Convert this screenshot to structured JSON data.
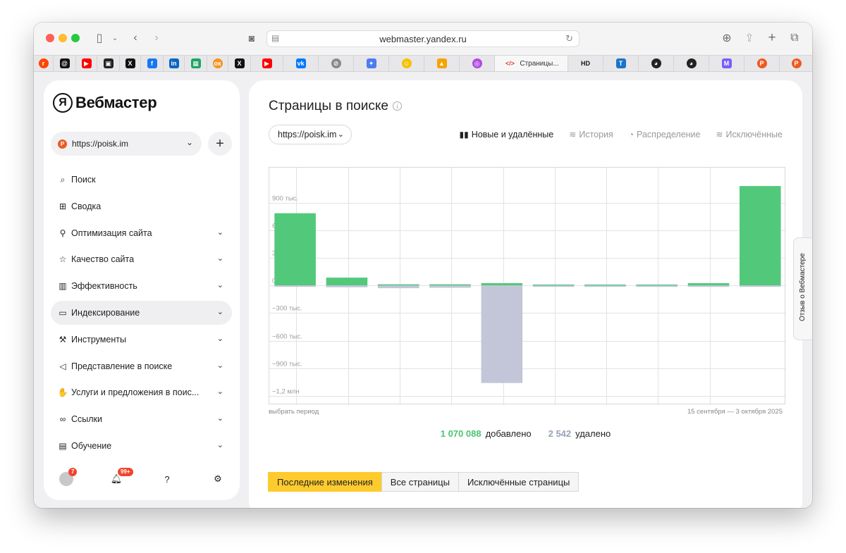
{
  "browser": {
    "address": "webmaster.yandex.ru",
    "tabs": [
      {
        "icon": "reddit-icon",
        "color": "#ff4500",
        "glyph": "r"
      },
      {
        "icon": "threads-icon",
        "color": "#111111",
        "glyph": "@"
      },
      {
        "icon": "youtube-icon",
        "color": "#ff0000",
        "glyph": "▶"
      },
      {
        "icon": "square-app-icon",
        "color": "#222222",
        "glyph": "▣"
      },
      {
        "icon": "x-icon",
        "color": "#111111",
        "glyph": "X"
      },
      {
        "icon": "facebook-icon",
        "color": "#1877f2",
        "glyph": "f"
      },
      {
        "icon": "linkedin-icon",
        "color": "#0a66c2",
        "glyph": "in"
      },
      {
        "icon": "sheets-icon",
        "color": "#1fa463",
        "glyph": "▦"
      },
      {
        "icon": "odnoklassniki-icon",
        "color": "#f7931e",
        "glyph": "ок"
      },
      {
        "icon": "x-icon",
        "color": "#111111",
        "glyph": "X"
      },
      {
        "icon": "youtube-icon",
        "color": "#ff0000",
        "glyph": "▶"
      },
      {
        "icon": "vk-icon",
        "color": "#0077ff",
        "glyph": "vk"
      },
      {
        "icon": "compass-icon",
        "color": "#8a8a8a",
        "glyph": "⊘"
      },
      {
        "icon": "gemini-icon",
        "color": "#4a7df0",
        "glyph": "✦"
      },
      {
        "icon": "smiley-icon",
        "color": "#f4c300",
        "glyph": "☺"
      },
      {
        "icon": "analytics-icon",
        "color": "#f4a400",
        "glyph": "▲"
      },
      {
        "icon": "podcast-icon",
        "color": "#b04be0",
        "glyph": "◎"
      },
      {
        "icon": "code-icon",
        "color": "#e23d2d",
        "glyph": "</>",
        "title": "Страницы...",
        "active": true
      },
      {
        "icon": "hd-icon",
        "color": "#111111",
        "glyph": "HD"
      },
      {
        "icon": "t-icon",
        "color": "#1a73c9",
        "glyph": "T"
      },
      {
        "icon": "ninja-icon",
        "color": "#222222",
        "glyph": "◕"
      },
      {
        "icon": "ninja-icon",
        "color": "#222222",
        "glyph": "◕"
      },
      {
        "icon": "m-icon",
        "color": "#7b5cff",
        "glyph": "M"
      },
      {
        "icon": "poisk-icon",
        "color": "#ee5a22",
        "glyph": "P"
      },
      {
        "icon": "poisk-icon",
        "color": "#ee5a22",
        "glyph": "P"
      }
    ]
  },
  "sidebar": {
    "logo_mark": "Я",
    "logo_text": "Вебмастер",
    "site_url": "https://poisk.im",
    "add_label": "+",
    "items": [
      {
        "label": "Поиск",
        "icon": "search-icon",
        "glyph": "⌕",
        "chevron": false
      },
      {
        "label": "Сводка",
        "icon": "grid-icon",
        "glyph": "⊞",
        "chevron": false
      },
      {
        "label": "Оптимизация сайта",
        "icon": "sitemap-icon",
        "glyph": "⚲",
        "chevron": true
      },
      {
        "label": "Качество сайта",
        "icon": "star-icon",
        "glyph": "☆",
        "chevron": true
      },
      {
        "label": "Эффективность",
        "icon": "bar-chart-icon",
        "glyph": "▥",
        "chevron": true
      },
      {
        "label": "Индексирование",
        "icon": "monitor-icon",
        "glyph": "▭",
        "chevron": true,
        "active": true
      },
      {
        "label": "Инструменты",
        "icon": "wrench-icon",
        "glyph": "⚒",
        "chevron": true
      },
      {
        "label": "Представление в поиске",
        "icon": "megaphone-icon",
        "glyph": "◁",
        "chevron": true
      },
      {
        "label": "Услуги и предложения в поис...",
        "icon": "hand-icon",
        "glyph": "✋",
        "chevron": true
      },
      {
        "label": "Ссылки",
        "icon": "link-icon",
        "glyph": "∞",
        "chevron": true
      },
      {
        "label": "Обучение",
        "icon": "book-icon",
        "glyph": "▤",
        "chevron": true
      }
    ],
    "avatar_badge": "7",
    "notifications_badge": "99+"
  },
  "main": {
    "title": "Страницы в поиске",
    "url_select": "https://poisk.im",
    "view_tabs": [
      {
        "label": "Новые и удалённые",
        "icon": "bars-icon",
        "glyph": "▮▮",
        "active": true
      },
      {
        "label": "История",
        "icon": "layers-icon",
        "glyph": "≋",
        "active": false
      },
      {
        "label": "Распределение",
        "icon": "pie-icon",
        "glyph": "◔",
        "active": false
      },
      {
        "label": "Исключённые",
        "icon": "layers-icon",
        "glyph": "≋",
        "active": false
      }
    ],
    "period_link": "выбрать период",
    "period_range": "15 сентября — 3 октября 2025",
    "added_value": "1 070 088",
    "added_label": "добавлено",
    "deleted_value": "2 542",
    "deleted_label": "удалено",
    "buttons": [
      "Последние изменения",
      "Все страницы",
      "Исключённые страницы"
    ],
    "feedback": "Отзыв о Вебмастере"
  },
  "chart_data": {
    "type": "bar",
    "ylim": [
      -1300000,
      1280000
    ],
    "grid": true,
    "yticks": [
      {
        "value": 900000,
        "label": "900 тыс."
      },
      {
        "value": 600000,
        "label": "600 тыс."
      },
      {
        "value": 300000,
        "label": "300 тыс."
      },
      {
        "value": 0,
        "label": "0"
      },
      {
        "value": -300000,
        "label": "−300 тыс."
      },
      {
        "value": -600000,
        "label": "−600 тыс."
      },
      {
        "value": -900000,
        "label": "−900 тыс."
      },
      {
        "value": -1200000,
        "label": "−1,2 млн"
      }
    ],
    "series": [
      {
        "name": "добавлено",
        "color": "#52c97a",
        "values": [
          785000,
          85000,
          12000,
          12000,
          25000,
          10000,
          10000,
          10000,
          25000,
          1080000
        ]
      },
      {
        "name": "удалено",
        "color": "#c3c6d8",
        "values": [
          -15000,
          -20000,
          -30000,
          -25000,
          -1060000,
          -10000,
          -10000,
          -10000,
          -10000,
          -10000
        ]
      }
    ]
  }
}
